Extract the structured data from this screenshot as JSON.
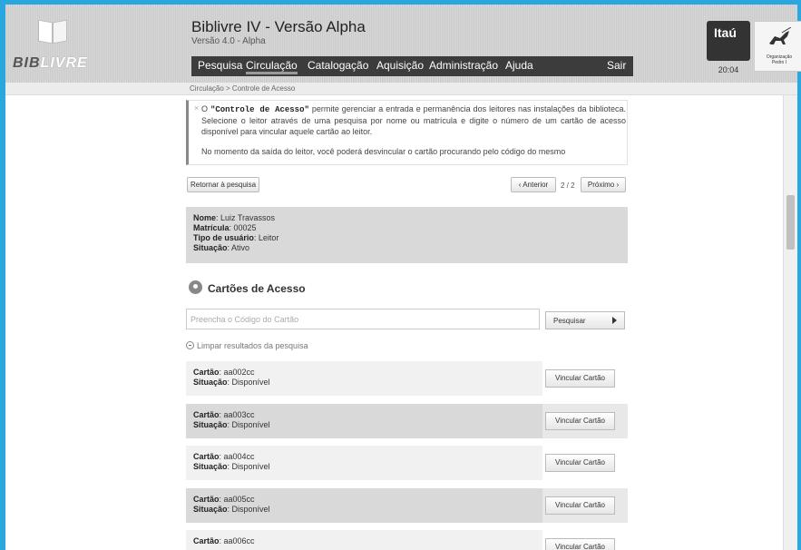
{
  "app": {
    "title": "Biblivre IV - Versão Alpha",
    "version": "Versão 4.0 - Alpha",
    "logo_text_bib": "BIB",
    "logo_text_livre": "LIVRE"
  },
  "menu": [
    {
      "label": "Pesquisa",
      "active": false
    },
    {
      "label": "Circulação",
      "active": true
    },
    {
      "label": "Catalogação",
      "active": false
    },
    {
      "label": "Aquisição",
      "active": false
    },
    {
      "label": "Administração",
      "active": false
    },
    {
      "label": "Ajuda",
      "active": false
    }
  ],
  "logout_label": "Sair",
  "sponsor": {
    "name": "Itaú",
    "time": "20:04",
    "org_line1": "Organização",
    "org_line2": "Pedro I"
  },
  "breadcrumb": "Circulação > Controle de Acesso",
  "info": {
    "close": "×",
    "text_lead": "O ",
    "text_bold": "\"Controle de Acesso\"",
    "text_rest": " permite gerenciar a entrada e permanência dos leitores nas instalações da biblioteca. Selecione o leitor através de uma pesquisa por nome ou matrícula e digite o número de um cartão de acesso disponível para vincular aquele cartão ao leitor.",
    "text2": "No momento da saída do leitor, você poderá desvincular o cartão procurando pelo código do mesmo"
  },
  "nav": {
    "back_label": "Retornar à pesquisa",
    "prev_label": "‹ Anterior",
    "page": "2 / 2",
    "next_label": "Próximo ›"
  },
  "reader": {
    "name_label": "Nome",
    "name": ": Luiz Travassos",
    "id_label": "Matrícula",
    "id": ": 00025",
    "type_label": "Tipo de usuário",
    "type": ": Leitor",
    "status_label": "Situação",
    "status": ": Ativo"
  },
  "cards_section": {
    "title": "Cartões de Acesso",
    "search_placeholder": "Preencha o Código do Cartão",
    "search_label": "Pesquisar",
    "clear_label": "Limpar resultados da pesquisa"
  },
  "cards": [
    {
      "label": "Cartão",
      "code": ": aa002cc",
      "status_label": "Situação",
      "status": ": Disponível",
      "action": "Vincular Cartão"
    },
    {
      "label": "Cartão",
      "code": ": aa003cc",
      "status_label": "Situação",
      "status": ": Disponível",
      "action": "Vincular Cartão"
    },
    {
      "label": "Cartão",
      "code": ": aa004cc",
      "status_label": "Situação",
      "status": ": Disponível",
      "action": "Vincular Cartão"
    },
    {
      "label": "Cartão",
      "code": ": aa005cc",
      "status_label": "Situação",
      "status": ": Disponível",
      "action": "Vincular Cartão"
    },
    {
      "label": "Cartão",
      "code": ": aa006cc",
      "status_label": "",
      "status": "",
      "action": "Vincular Cartão"
    }
  ]
}
